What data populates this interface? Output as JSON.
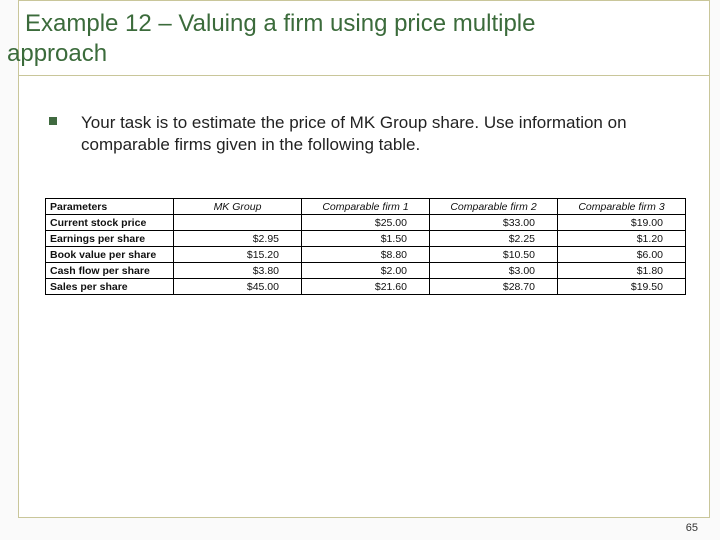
{
  "title_line1": "Example 12 – Valuing a firm using price multiple",
  "title_line2": "approach",
  "bullet": "Your task is to estimate the price of MK Group share. Use information on comparable firms given in the following table.",
  "table": {
    "headers": [
      "Parameters",
      "MK Group",
      "Comparable firm 1",
      "Comparable firm 2",
      "Comparable firm 3"
    ],
    "rows": [
      {
        "label": "Current stock price",
        "cells": [
          "",
          "$25.00",
          "$33.00",
          "$19.00"
        ]
      },
      {
        "label": "Earnings per share",
        "cells": [
          "$2.95",
          "$1.50",
          "$2.25",
          "$1.20"
        ]
      },
      {
        "label": "Book value per share",
        "cells": [
          "$15.20",
          "$8.80",
          "$10.50",
          "$6.00"
        ]
      },
      {
        "label": "Cash flow per share",
        "cells": [
          "$3.80",
          "$2.00",
          "$3.00",
          "$1.80"
        ]
      },
      {
        "label": "Sales per share",
        "cells": [
          "$45.00",
          "$21.60",
          "$28.70",
          "$19.50"
        ]
      }
    ]
  },
  "page_number": "65"
}
